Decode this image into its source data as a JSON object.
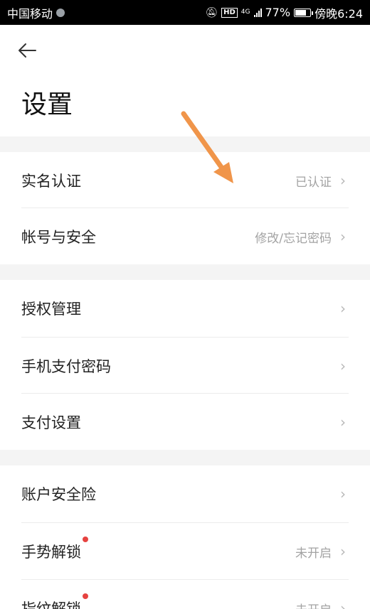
{
  "status_bar": {
    "carrier": "中国移动",
    "hd": "HD",
    "network": "4G",
    "battery_percent": "77%",
    "battery_level": 0.77,
    "time": "傍晚6:24"
  },
  "header": {
    "title": "设置"
  },
  "sections": [
    {
      "items": [
        {
          "label": "实名认证",
          "value": "已认证"
        },
        {
          "label": "帐号与安全",
          "value": "修改/忘记密码"
        }
      ]
    },
    {
      "items": [
        {
          "label": "授权管理",
          "value": ""
        },
        {
          "label": "手机支付密码",
          "value": ""
        },
        {
          "label": "支付设置",
          "value": ""
        }
      ]
    },
    {
      "items": [
        {
          "label": "账户安全险",
          "value": ""
        },
        {
          "label": "手势解锁",
          "value": "未开启",
          "red_dot": true
        },
        {
          "label": "指纹解锁",
          "value": "未开启",
          "red_dot": true
        }
      ]
    }
  ],
  "chevron": "›",
  "colors": {
    "annotation_arrow": "#f0954a",
    "red_dot": "#e64340",
    "section_gap": "#f4f4f4"
  }
}
